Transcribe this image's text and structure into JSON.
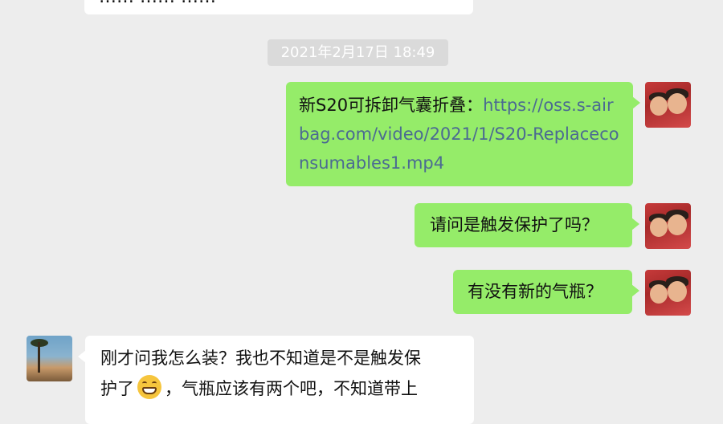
{
  "conversation": {
    "partial_top_message": "…… …… ……",
    "timestamp": "2021年2月17日 18:49",
    "messages": [
      {
        "sender": "me",
        "prefix": "新S20可拆卸气囊折叠：",
        "link": "https://oss.s-airbag.com/video/2021/1/S20-Replaceconsumables1.mp4"
      },
      {
        "sender": "me",
        "text": "请问是触发保护了吗？"
      },
      {
        "sender": "me",
        "text": "有没有新的气瓶？"
      },
      {
        "sender": "other",
        "text_part1": "刚才问我怎么装？我也不知道是不是触发保",
        "text_part2": "护了",
        "emoji": "grin-emoji",
        "text_part3": "，气瓶应该有两个吧，不知道带上"
      }
    ]
  },
  "colors": {
    "background": "#ededed",
    "outgoing_bubble": "#95ec69",
    "incoming_bubble": "#ffffff",
    "link": "#4b6a92",
    "timestamp_bg": "#dadada"
  }
}
